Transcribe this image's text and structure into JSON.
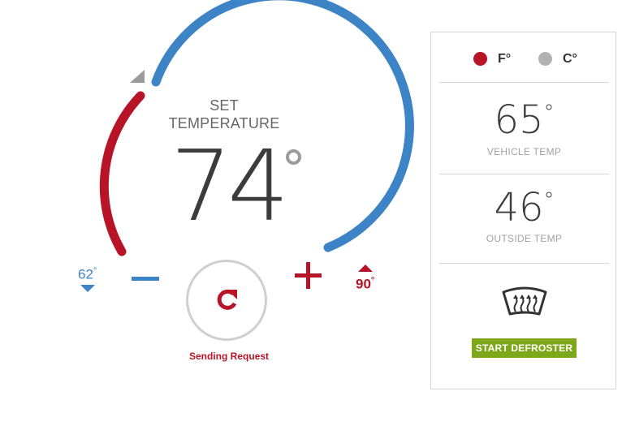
{
  "thermostat": {
    "set_label_line1": "SET",
    "set_label_line2": "TEMPERATURE",
    "set_temperature": "74",
    "min_temp": "62",
    "max_temp": "90",
    "degree_symbol": "°",
    "status_text": "Sending Request",
    "colors": {
      "cool": "#3d84c6",
      "heat": "#b81427",
      "neutral": "#9b9b9b"
    },
    "icons": {
      "decrease": "minus-icon",
      "increase": "plus-icon",
      "refresh": "refresh-icon",
      "pointer": "triangle-pointer-icon"
    }
  },
  "units": {
    "fahrenheit": {
      "label": "F°",
      "selected": true,
      "color": "#b81427"
    },
    "celsius": {
      "label": "C°",
      "selected": false,
      "color": "#b2b2b2"
    }
  },
  "vehicle_temp": {
    "value": "65",
    "degree": "°",
    "label": "VEHICLE TEMP"
  },
  "outside_temp": {
    "value": "46",
    "degree": "°",
    "label": "OUTSIDE TEMP"
  },
  "defroster": {
    "icon": "windshield-defrost-icon",
    "button_label": "START DEFROSTER",
    "color": "#7ea719"
  }
}
